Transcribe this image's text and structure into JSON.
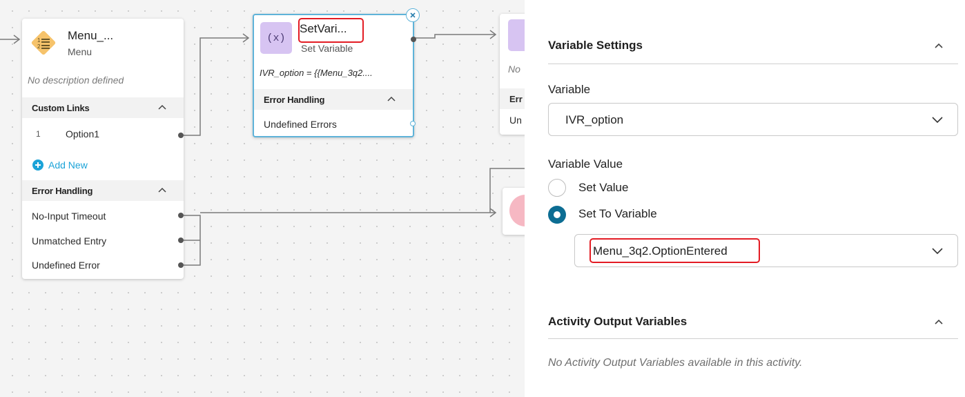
{
  "canvas": {
    "menu_node": {
      "title": "Menu_...",
      "subtitle": "Menu",
      "description": "No description defined",
      "custom_links_header": "Custom Links",
      "options": [
        {
          "index": "1",
          "label": "Option1"
        }
      ],
      "add_new": "Add New",
      "error_handling_header": "Error Handling",
      "error_rows": [
        "No-Input Timeout",
        "Unmatched Entry",
        "Undefined Error"
      ]
    },
    "setvar_node": {
      "title": "SetVari...",
      "subtitle": "Set Variable",
      "expression": "IVR_option = {{Menu_3q2....",
      "error_handling_header": "Error Handling",
      "undefined_errors": "Undefined Errors",
      "icon_glyph": "(x)"
    },
    "partial_node_1": {
      "desc": "No",
      "header": "Err",
      "row": "Un"
    }
  },
  "panel": {
    "variable_settings_header": "Variable Settings",
    "variable_label": "Variable",
    "variable_value": "IVR_option",
    "variable_value_label": "Variable Value",
    "radio_options": [
      {
        "label": "Set Value",
        "checked": false
      },
      {
        "label": "Set To Variable",
        "checked": true
      }
    ],
    "source_variable": "Menu_3q2.OptionEntered",
    "activity_output_header": "Activity Output Variables",
    "activity_output_note": "No Activity Output Variables available in this activity."
  },
  "colors": {
    "menu_icon": "#f6c36b",
    "setvar_icon": "#d7c4f2",
    "selected_border": "#5eb3d9",
    "add_new": "#1ba3d8",
    "radio_checked": "#0c6d93",
    "highlight": "#e31b23"
  }
}
